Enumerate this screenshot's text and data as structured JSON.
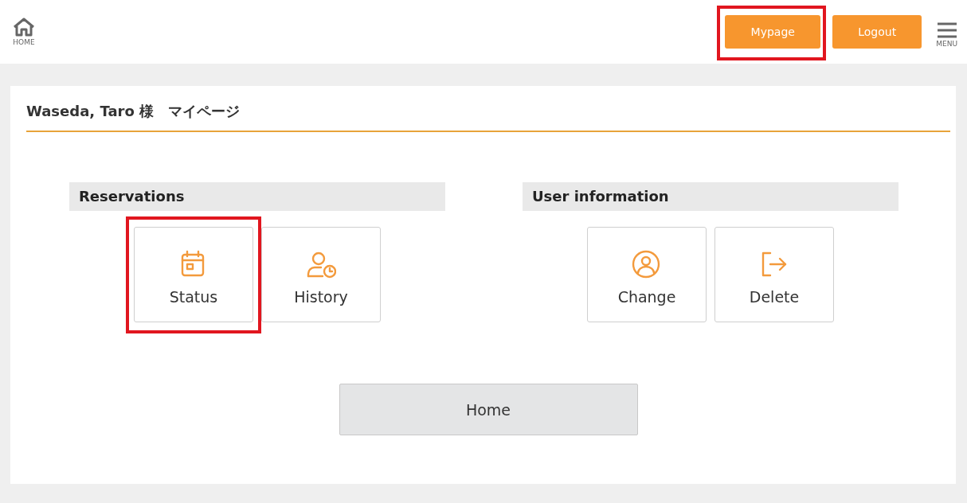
{
  "header": {
    "home_label": "HOME",
    "buttons": [
      {
        "label": "Mypage",
        "highlighted": true
      },
      {
        "label": "Logout",
        "highlighted": false
      }
    ],
    "menu_label": "MENU"
  },
  "page_title": "Waseda, Taro 様　マイページ",
  "sections": [
    {
      "heading": "Reservations",
      "tiles": [
        {
          "kind": "calendar",
          "label": "Status",
          "highlighted": true
        },
        {
          "kind": "history",
          "label": "History",
          "highlighted": false
        }
      ]
    },
    {
      "heading": "User information",
      "tiles": [
        {
          "kind": "profile",
          "label": "Change",
          "highlighted": false
        },
        {
          "kind": "exit",
          "label": "Delete",
          "highlighted": false
        }
      ]
    }
  ],
  "home_button": "Home"
}
